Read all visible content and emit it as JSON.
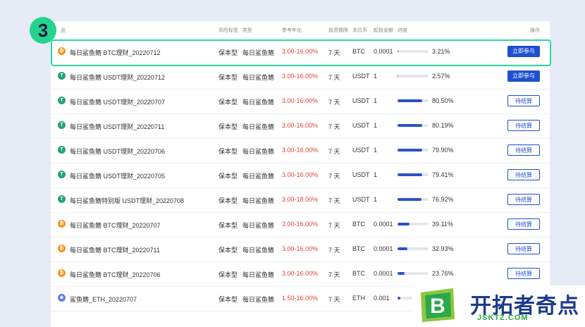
{
  "step_number": "3",
  "headers": {
    "name": "品",
    "risk": "风险标签",
    "type": "类型",
    "rate": "参考年化",
    "term": "投资期限",
    "currency": "本位币",
    "min": "起投金额",
    "progress": "进度",
    "action": "操作"
  },
  "rows": [
    {
      "coin": "btc",
      "coin_glyph": "₿",
      "name": "每日鲨鱼鳍 BTC理财_20220712",
      "risk": "保本型",
      "type": "每日鲨鱼鳍",
      "rate": "3.00-16.00%",
      "term": "7 天",
      "currency": "BTC",
      "min": "0.0001",
      "progress": 3.21,
      "pct": "3.21%",
      "action": "立即参与",
      "action_style": "primary"
    },
    {
      "coin": "usdt",
      "coin_glyph": "T",
      "name": "每日鲨鱼鳍 USDT理财_20220712",
      "risk": "保本型",
      "type": "每日鲨鱼鳍",
      "rate": "3.00-16.00%",
      "term": "7 天",
      "currency": "USDT",
      "min": "1",
      "progress": 2.57,
      "pct": "2.57%",
      "action": "立即参与",
      "action_style": "primary"
    },
    {
      "coin": "usdt",
      "coin_glyph": "T",
      "name": "每日鲨鱼鳍 USDT理财_20220707",
      "risk": "保本型",
      "type": "每日鲨鱼鳍",
      "rate": "3.00-16.00%",
      "term": "7 天",
      "currency": "USDT",
      "min": "1",
      "progress": 80.5,
      "pct": "80.50%",
      "action": "待结算",
      "action_style": "outline"
    },
    {
      "coin": "usdt",
      "coin_glyph": "T",
      "name": "每日鲨鱼鳍 USDT理财_20220711",
      "risk": "保本型",
      "type": "每日鲨鱼鳍",
      "rate": "3.00-16.00%",
      "term": "7 天",
      "currency": "USDT",
      "min": "1",
      "progress": 80.19,
      "pct": "80.19%",
      "action": "待结算",
      "action_style": "outline"
    },
    {
      "coin": "usdt",
      "coin_glyph": "T",
      "name": "每日鲨鱼鳍 USDT理财_20220706",
      "risk": "保本型",
      "type": "每日鲨鱼鳍",
      "rate": "3.00-16.00%",
      "term": "7 天",
      "currency": "USDT",
      "min": "1",
      "progress": 79.9,
      "pct": "79.90%",
      "action": "待结算",
      "action_style": "outline"
    },
    {
      "coin": "usdt",
      "coin_glyph": "T",
      "name": "每日鲨鱼鳍 USDT理财_20220705",
      "risk": "保本型",
      "type": "每日鲨鱼鳍",
      "rate": "3.00-16.00%",
      "term": "7 天",
      "currency": "USDT",
      "min": "1",
      "progress": 79.41,
      "pct": "79.41%",
      "action": "待结算",
      "action_style": "outline"
    },
    {
      "coin": "usdt",
      "coin_glyph": "T",
      "name": "每日鲨鱼鳍特别版 USDT理财_20220708",
      "risk": "保本型",
      "type": "每日鲨鱼鳍",
      "rate": "3.00-18.00%",
      "term": "7 天",
      "currency": "USDT",
      "min": "1",
      "progress": 76.92,
      "pct": "76.92%",
      "action": "待结算",
      "action_style": "outline"
    },
    {
      "coin": "btc",
      "coin_glyph": "₿",
      "name": "每日鲨鱼鳍 BTC理财_20220707",
      "risk": "保本型",
      "type": "每日鲨鱼鳍",
      "rate": "3.00-16.00%",
      "term": "7 天",
      "currency": "BTC",
      "min": "0.0001",
      "progress": 39.11,
      "pct": "39.11%",
      "action": "待结算",
      "action_style": "outline"
    },
    {
      "coin": "btc",
      "coin_glyph": "₿",
      "name": "每日鲨鱼鳍 BTC理财_20220711",
      "risk": "保本型",
      "type": "每日鲨鱼鳍",
      "rate": "3.00-16.00%",
      "term": "7 天",
      "currency": "BTC",
      "min": "0.0001",
      "progress": 32.93,
      "pct": "32.93%",
      "action": "待结算",
      "action_style": "outline"
    },
    {
      "coin": "btc",
      "coin_glyph": "₿",
      "name": "每日鲨鱼鳍 BTC理财_20220706",
      "risk": "保本型",
      "type": "每日鲨鱼鳍",
      "rate": "3.00-16.00%",
      "term": "7 天",
      "currency": "BTC",
      "min": "0.0001",
      "progress": 23.76,
      "pct": "23.76%",
      "action": "待结算",
      "action_style": "outline"
    },
    {
      "coin": "eth",
      "coin_glyph": "◆",
      "name": "鲨鱼鳍_ETH_20220707",
      "risk": "保本型",
      "type": "每日鲨鱼鳍",
      "rate": "1.50-16.00%",
      "term": "7 天",
      "currency": "ETH",
      "min": "0.001",
      "progress": 10,
      "pct": "",
      "action": "",
      "action_style": "none"
    }
  ],
  "logo": {
    "brand_text": "开拓者奇点",
    "url_text": "JSKTZ.COM",
    "mark_letter": "B",
    "colors": {
      "green": "#2aa84a",
      "blue": "#1d3a8c",
      "lime": "#8cc63f"
    }
  },
  "accent_colors": {
    "primary": "#1c4fd1",
    "rate": "#e0403a",
    "highlight": "#2fd8a3"
  }
}
